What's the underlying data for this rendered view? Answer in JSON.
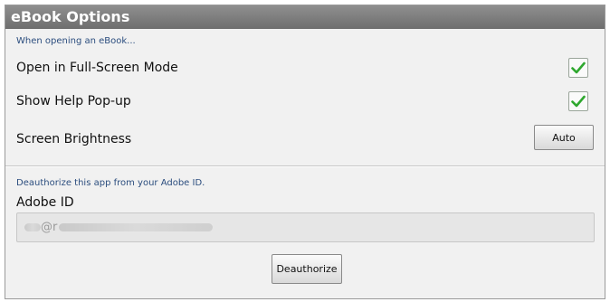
{
  "window": {
    "title": "eBook Options"
  },
  "opening_section": {
    "header": "When opening an eBook...",
    "full_screen": {
      "label": "Open in Full-Screen Mode",
      "checked": true
    },
    "help_popup": {
      "label": "Show Help Pop-up",
      "checked": true
    },
    "brightness": {
      "label": "Screen Brightness",
      "button_label": "Auto"
    }
  },
  "deauth_section": {
    "header": "Deauthorize this app from your Adobe ID.",
    "adobe_id_label": "Adobe ID",
    "adobe_id_value": "@r",
    "deauthorize_label": "Deauthorize"
  },
  "colors": {
    "check": "#2fa82f",
    "section_header": "#2b4d7e",
    "titlebar": "#7a7a7a"
  },
  "icons": {
    "checkbox_check": "checkmark-icon"
  }
}
